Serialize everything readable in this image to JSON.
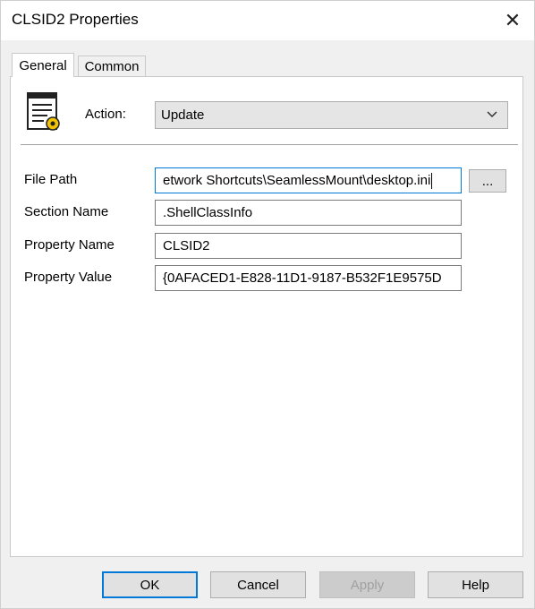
{
  "window": {
    "title": "CLSID2 Properties",
    "close_glyph": "✕"
  },
  "tabs": [
    {
      "label": "General",
      "active": true
    },
    {
      "label": "Common",
      "active": false
    }
  ],
  "action": {
    "label": "Action:",
    "selected": "Update",
    "icon": "ini-file-icon"
  },
  "fields": {
    "file_path": {
      "label": "File Path",
      "value": "etwork Shortcuts\\SeamlessMount\\desktop.ini"
    },
    "section_name": {
      "label": "Section Name",
      "value": ".ShellClassInfo"
    },
    "property_name": {
      "label": "Property Name",
      "value": "CLSID2"
    },
    "property_value": {
      "label": "Property Value",
      "value": "{0AFACED1-E828-11D1-9187-B532F1E9575D"
    }
  },
  "browse_label": "...",
  "buttons": {
    "ok": "OK",
    "cancel": "Cancel",
    "apply": "Apply",
    "help": "Help"
  },
  "colors": {
    "accent": "#0078d7",
    "dialog_bg": "#f0f0f0"
  }
}
